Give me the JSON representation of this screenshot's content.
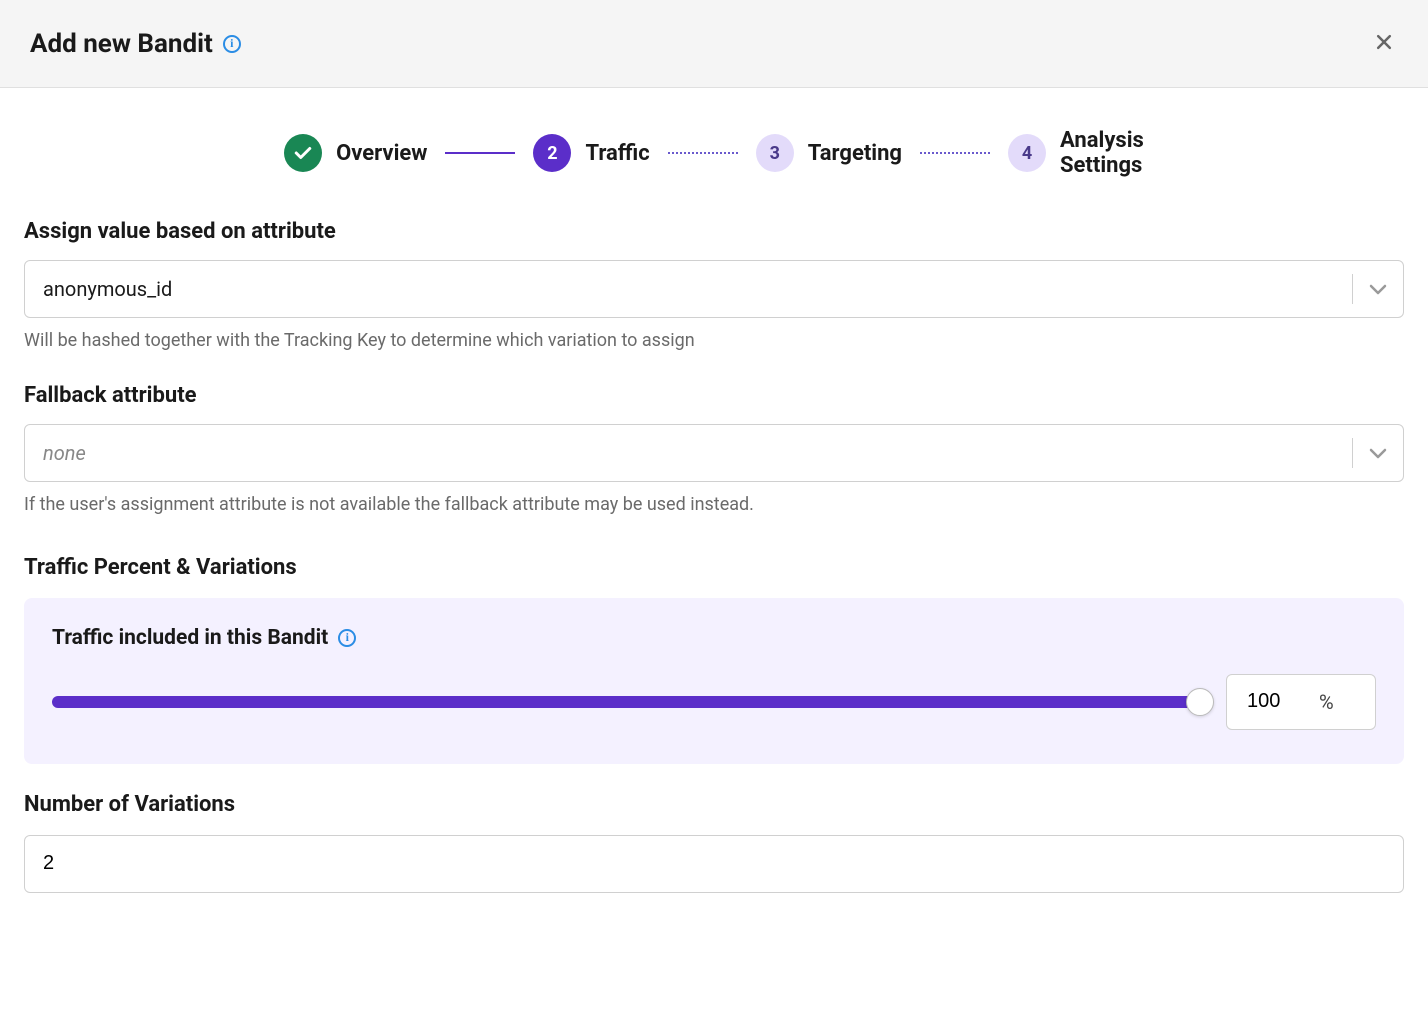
{
  "header": {
    "title": "Add new Bandit"
  },
  "stepper": {
    "steps": [
      {
        "label": "Overview",
        "state": "done"
      },
      {
        "label": "Traffic",
        "state": "active",
        "number": "2"
      },
      {
        "label": "Targeting",
        "state": "pending",
        "number": "3"
      },
      {
        "label": "Analysis\nSettings",
        "state": "pending",
        "number": "4"
      }
    ]
  },
  "attribute": {
    "label": "Assign value based on attribute",
    "value": "anonymous_id",
    "help": "Will be hashed together with the Tracking Key to determine which variation to assign"
  },
  "fallback": {
    "label": "Fallback attribute",
    "placeholder": "none",
    "help": "If the user's assignment attribute is not available the fallback attribute may be used instead."
  },
  "traffic": {
    "section_label": "Traffic Percent & Variations",
    "card_title": "Traffic included in this Bandit",
    "percent_value": "100",
    "percent_sign": "%"
  },
  "variations": {
    "label": "Number of Variations",
    "value": "2"
  }
}
